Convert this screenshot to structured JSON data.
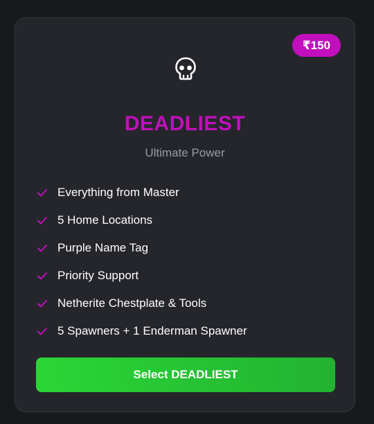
{
  "plan": {
    "price": "₹150",
    "icon": "skull-icon",
    "title": "DEADLIEST",
    "subtitle": "Ultimate Power",
    "features": [
      "Everything from Master",
      "5 Home Locations",
      "Purple Name Tag",
      "Priority Support",
      "Netherite Chestplate & Tools",
      "5 Spawners + 1 Enderman Spawner"
    ],
    "button_label": "Select DEADLIEST"
  },
  "colors": {
    "background": "#18191c",
    "card": "#25262b",
    "accent": "#c20fbe",
    "button_start": "#2ad636",
    "button_end": "#23b231",
    "subtitle": "#9a9ca3"
  }
}
